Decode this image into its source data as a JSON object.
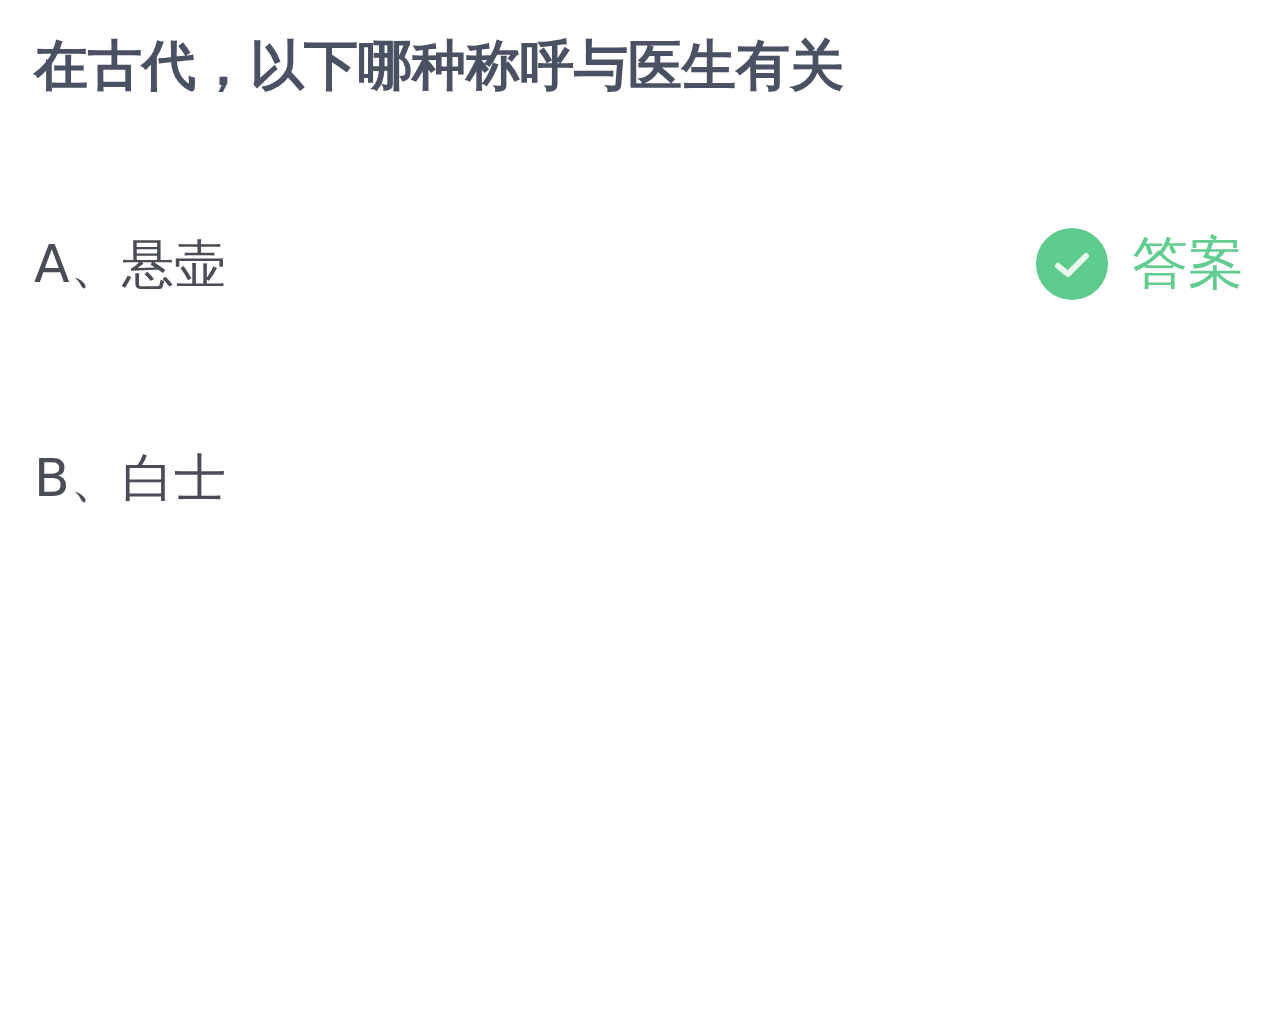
{
  "question": "在古代，以下哪种称呼与医生有关",
  "options": [
    {
      "label": "A、悬壶",
      "correct": true,
      "answer_label": "答案"
    },
    {
      "label": "B、白士",
      "correct": false
    }
  ]
}
